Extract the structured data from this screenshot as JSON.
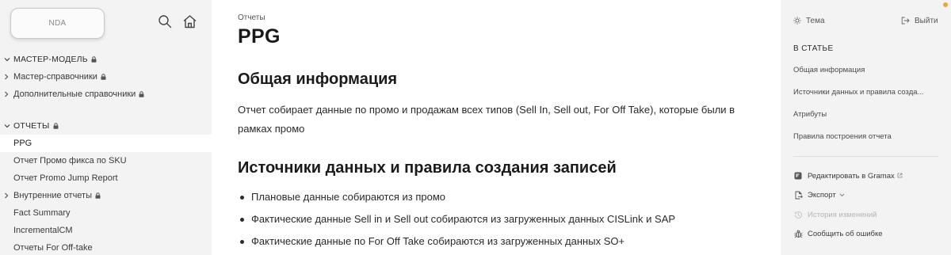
{
  "sidebar": {
    "logo_text": "NDA",
    "sections": [
      {
        "label": "МАСТЕР-МОДЕЛЬ",
        "items": [
          {
            "label": "Мастер-справочники"
          },
          {
            "label": "Дополнительные справочники"
          }
        ]
      },
      {
        "label": "ОТЧЕТЫ",
        "items": [
          {
            "label": "PPG"
          },
          {
            "label": "Отчет Промо фикса по SKU"
          },
          {
            "label": "Отчет Promo Jump Report"
          },
          {
            "label": "Внутренние отчеты"
          },
          {
            "label": "Fact Summary"
          },
          {
            "label": "IncrementalCM"
          },
          {
            "label": "Отчеты For Off-take"
          }
        ]
      }
    ]
  },
  "article": {
    "breadcrumb": "Отчеты",
    "title": "PPG",
    "section1_heading": "Общая информация",
    "section1_text": "Отчет собирает данные по промо и продажам всех типов (Sell In, Sell out, For Off Take), которые были в рамках промо",
    "section2_heading": "Источники данных и правила создания записей",
    "bullets": [
      "Плановые данные собираются из промо",
      "Фактические данные Sell in и Sell out собираются из загруженных данных CISLink и SAP",
      "Фактические данные по For Off Take собираются из загруженных данных SO+"
    ]
  },
  "right_panel": {
    "theme_label": "Тема",
    "logout_label": "Выйти",
    "toc_heading": "В СТАТЬЕ",
    "toc": [
      "Общая информация",
      "Источники данных и правила созда...",
      "Атрибуты",
      "Правила построения отчета"
    ],
    "actions": {
      "edit": "Редактировать в Gramax",
      "export": "Экспорт",
      "history": "История изменений",
      "report": "Сообщить об ошибке"
    }
  },
  "colors": {
    "sidebar_bg": "#f3f3f3",
    "active_bg": "#ffffff",
    "notification_dot": "#f0a23c"
  }
}
